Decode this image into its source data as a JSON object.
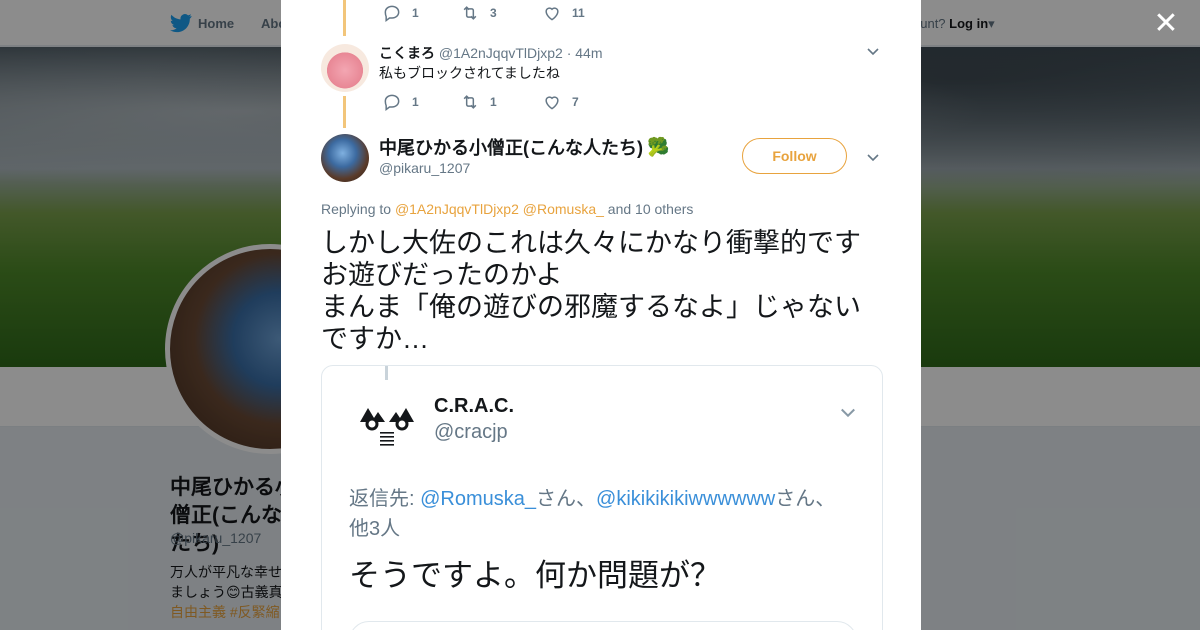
{
  "background": {
    "nav": {
      "home_label": "Home",
      "about_label": "Abo",
      "account_text": "ccount?",
      "login_label": "Log in"
    },
    "profile": {
      "name": "中尾ひかる小僧正(こんな人たち)",
      "handle": "@pikaru_1207",
      "bio_line1": "万人が平凡な幸せ",
      "bio_line2": "ましょう😊古義真",
      "bio_tags": "自由主義 #反緊縮"
    }
  },
  "thread": {
    "prev_actions": {
      "replies": "1",
      "retweets": "3",
      "likes": "11"
    },
    "reply": {
      "name": "こくまろ",
      "handle": "@1A2nJqqvTlDjxp2",
      "time": "· 44m",
      "text": "私もブロックされてましたね",
      "actions": {
        "replies": "1",
        "retweets": "1",
        "likes": "7"
      }
    }
  },
  "tweet": {
    "name": "中尾ひかる小僧正(こんな人たち)",
    "name_emoji": "🥦",
    "handle": "@pikaru_1207",
    "follow_label": "Follow",
    "replying_prefix": "Replying to",
    "mention1": "@1A2nJqqvTlDjxp2",
    "mention2": "@Romuska_",
    "replying_suffix": "and 10 others",
    "text_lines": [
      "しかし大佐のこれは久々にかなり衝撃的です",
      "お遊びだったのかよ",
      "まんま「俺の遊びの邪魔するなよ」じゃない",
      "ですか…"
    ]
  },
  "quoted": {
    "name": "C.R.A.C.",
    "handle": "@cracjp",
    "logo_text": "COUNTER RACIST ACTION COLLECTIVE",
    "reply_prefix": "返信先: ",
    "reply_mention1": "@Romuska_",
    "reply_mid": "さん、",
    "reply_mention2": "@kikikikikiwwwwww",
    "reply_suffix": "さん、他3人",
    "text": "そうですよ。何か問題が？"
  },
  "colors": {
    "accent": "#e8a33e",
    "twitter_blue": "#1da1f2",
    "muted": "#657786",
    "thread_line": "#f2c57a"
  }
}
